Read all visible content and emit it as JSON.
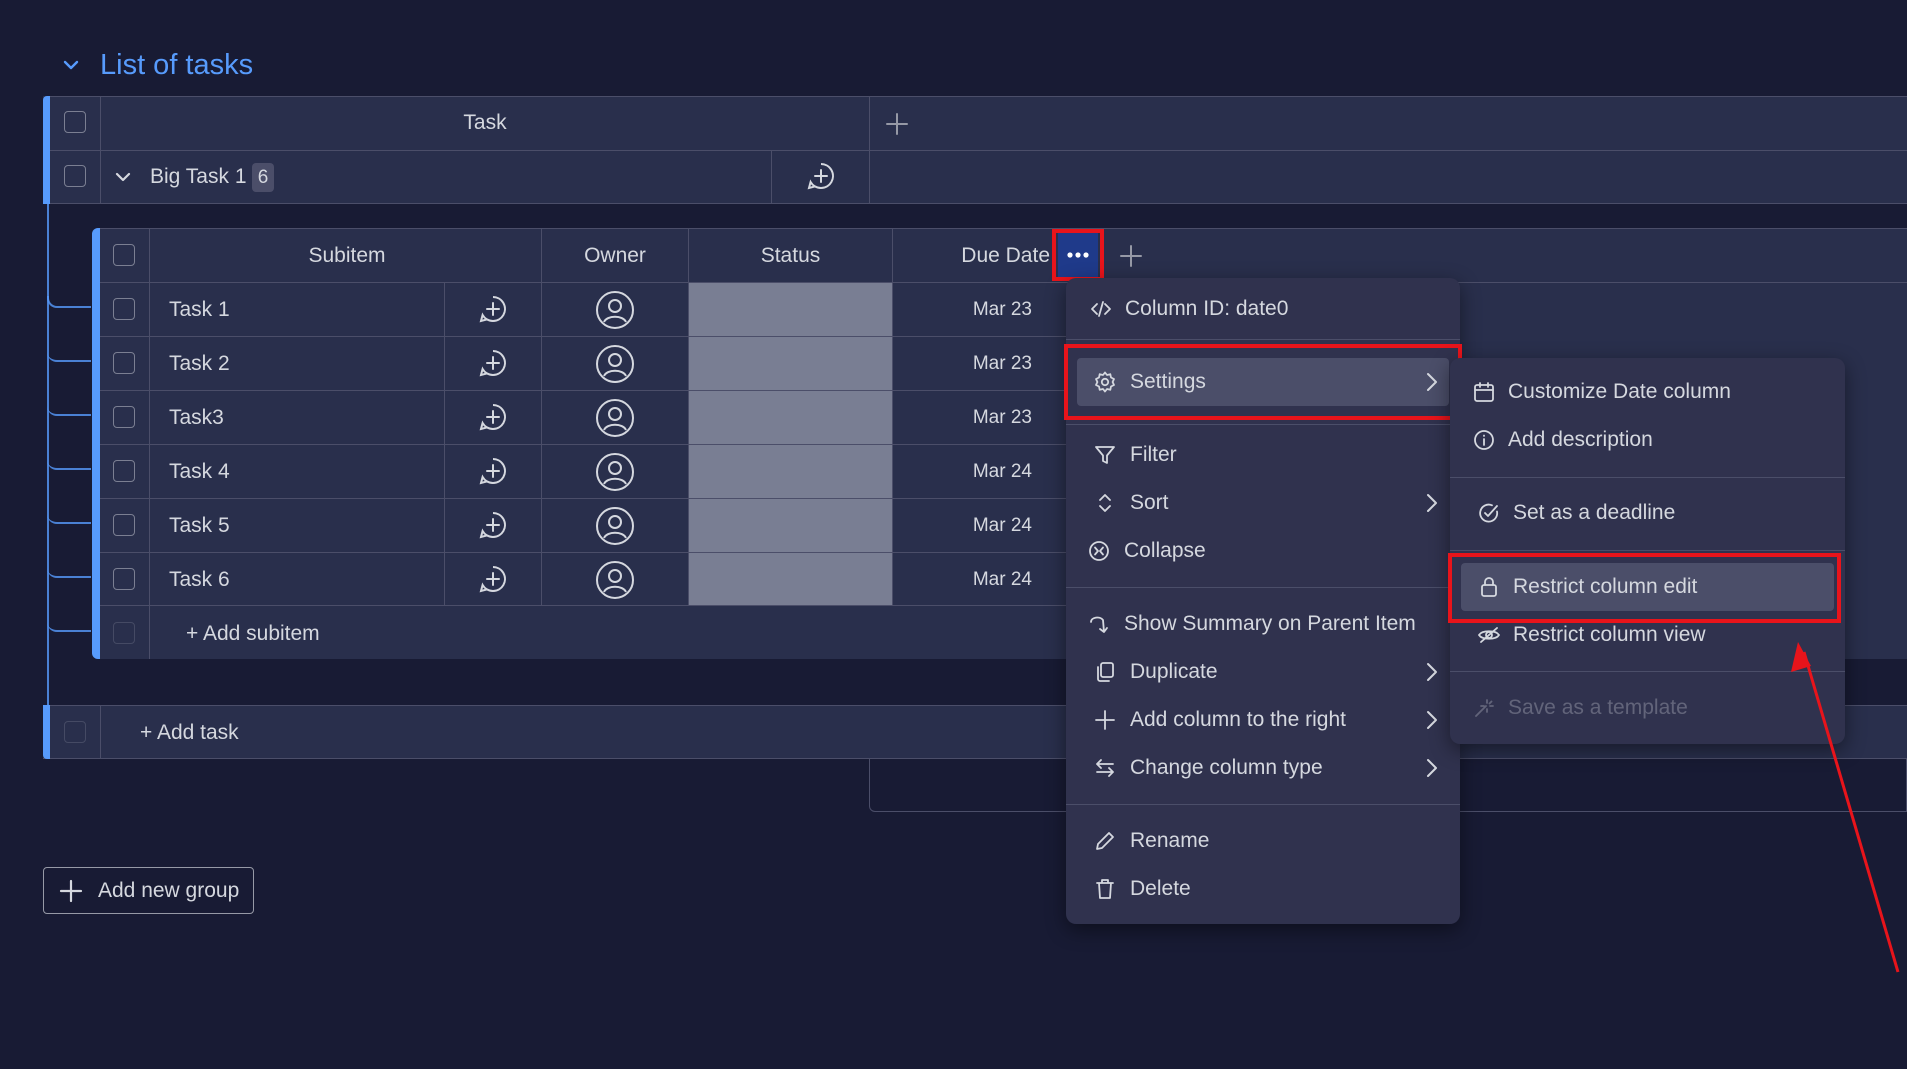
{
  "group": {
    "title": "List of tasks",
    "accent": "#579bfc"
  },
  "main_table": {
    "header_task": "Task",
    "item": {
      "name": "Big Task 1",
      "subitem_count": "6"
    },
    "add_task": "+ Add task"
  },
  "subitems": {
    "headers": {
      "subitem": "Subitem",
      "owner": "Owner",
      "status": "Status",
      "due_date": "Due Date"
    },
    "rows": [
      {
        "name": "Task 1",
        "date": "Mar 23"
      },
      {
        "name": "Task 2",
        "date": "Mar 23"
      },
      {
        "name": "Task3",
        "date": "Mar 23"
      },
      {
        "name": "Task 4",
        "date": "Mar 24"
      },
      {
        "name": "Task 5",
        "date": "Mar 24"
      },
      {
        "name": "Task 6",
        "date": "Mar 24"
      }
    ],
    "add_subitem": "+ Add subitem"
  },
  "add_group": "Add new group",
  "column_menu": {
    "column_id": "Column ID: date0",
    "settings": "Settings",
    "filter": "Filter",
    "sort": "Sort",
    "collapse": "Collapse",
    "show_summary": "Show Summary on Parent Item",
    "duplicate": "Duplicate",
    "add_column_right": "Add column to the right",
    "change_type": "Change column type",
    "rename": "Rename",
    "delete": "Delete"
  },
  "settings_submenu": {
    "customize": "Customize Date column",
    "add_description": "Add description",
    "set_deadline": "Set as a deadline",
    "restrict_edit": "Restrict column edit",
    "restrict_view": "Restrict column view",
    "save_template": "Save as a template"
  },
  "colors": {
    "background": "#181b34",
    "panel": "#30324e",
    "status_cell": "#797e93",
    "highlight": "#e8141b",
    "accent_blue": "#579bfc"
  }
}
